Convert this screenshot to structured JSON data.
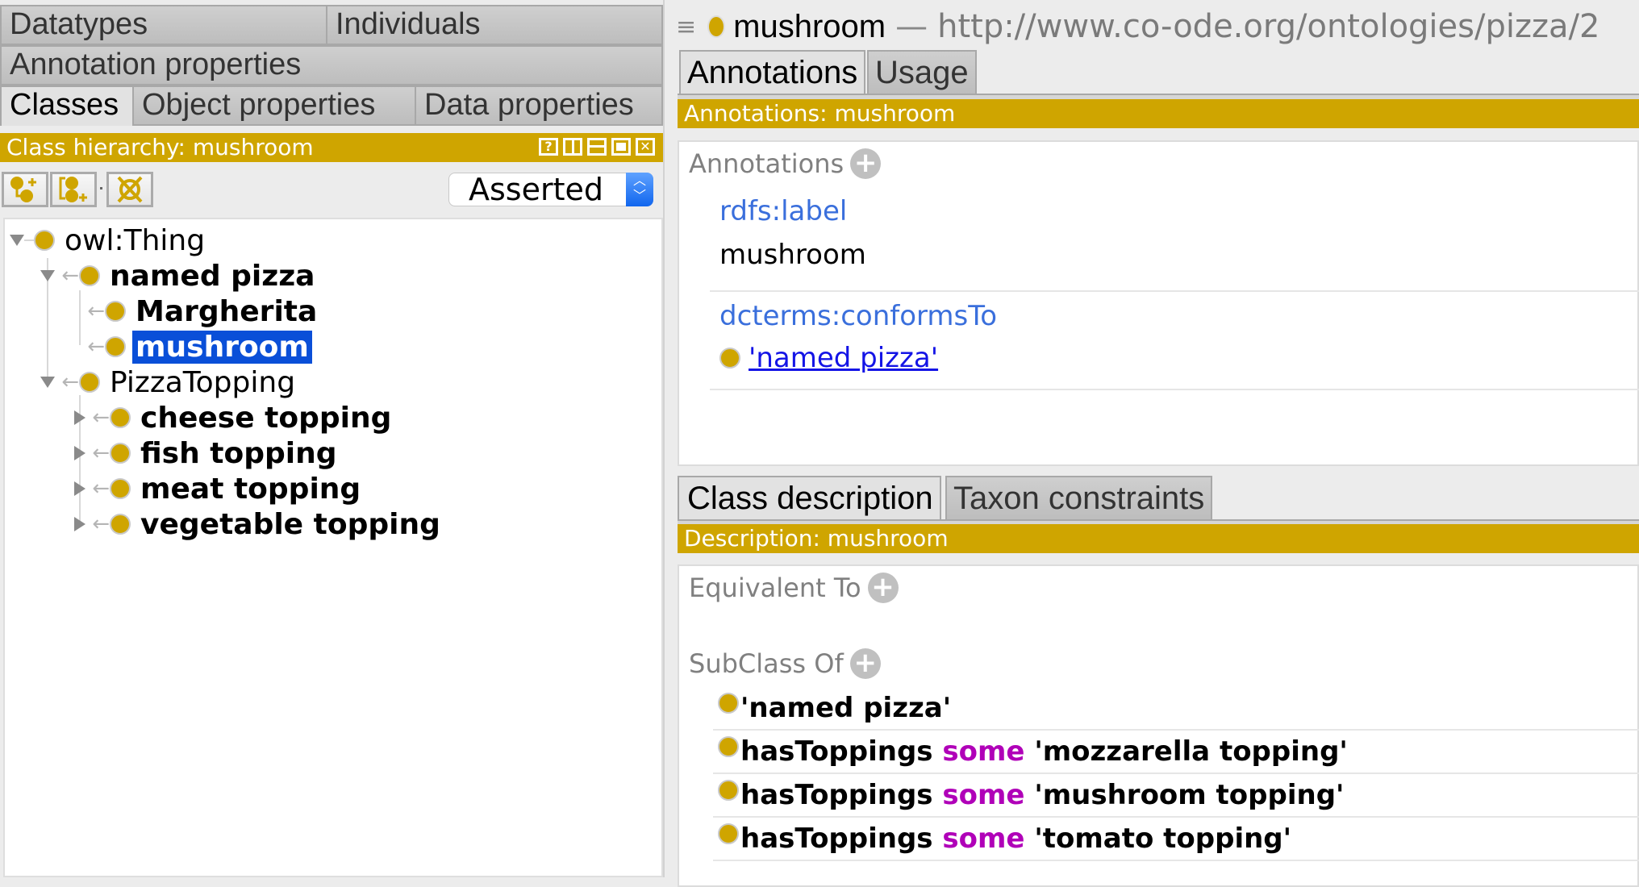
{
  "left_tabs": {
    "row1": [
      "Datatypes",
      "Individuals"
    ],
    "row2": [
      "Annotation properties"
    ],
    "row3": [
      "Classes",
      "Object properties",
      "Data properties"
    ],
    "active": "Classes"
  },
  "hierarchy": {
    "title": "Class hierarchy: mushroom",
    "window_buttons": [
      "?",
      "split-vertical",
      "split-horizontal",
      "maximize",
      "close"
    ],
    "toolbar": [
      "add-subclass",
      "add-sibling-class",
      "delete-class"
    ],
    "mode_select": "Asserted",
    "tree": [
      {
        "label": "owl:Thing",
        "level": 0,
        "expanded": true,
        "bold": false,
        "selected": false
      },
      {
        "label": "named pizza",
        "level": 1,
        "expanded": true,
        "bold": true,
        "selected": false
      },
      {
        "label": "Margherita",
        "level": 2,
        "expanded": null,
        "bold": true,
        "selected": false
      },
      {
        "label": "mushroom",
        "level": 2,
        "expanded": null,
        "bold": true,
        "selected": true
      },
      {
        "label": "PizzaTopping",
        "level": 1,
        "expanded": true,
        "bold": false,
        "selected": false
      },
      {
        "label": "cheese topping",
        "level": 2,
        "expanded": false,
        "bold": true,
        "selected": false
      },
      {
        "label": "fish topping",
        "level": 2,
        "expanded": false,
        "bold": true,
        "selected": false
      },
      {
        "label": "meat topping",
        "level": 2,
        "expanded": false,
        "bold": true,
        "selected": false
      },
      {
        "label": "vegetable topping",
        "level": 2,
        "expanded": false,
        "bold": true,
        "selected": false
      }
    ]
  },
  "header": {
    "entity": "mushroom",
    "separator": "—",
    "iri": "http://www.co-ode.org/ontologies/pizza/2"
  },
  "annotations_tabs": [
    "Annotations",
    "Usage"
  ],
  "annotations": {
    "title": "Annotations: mushroom",
    "section_label": "Annotations",
    "items": [
      {
        "property": "rdfs:label",
        "value": "mushroom",
        "is_link": false
      },
      {
        "property": "dcterms:conformsTo",
        "value": "'named pizza'",
        "is_link": true
      }
    ]
  },
  "description_tabs": [
    "Class description",
    "Taxon constraints"
  ],
  "description": {
    "title": "Description: mushroom",
    "equivalent_label": "Equivalent To",
    "subclass_label": "SubClass Of",
    "subclass_of": [
      {
        "prop": "",
        "kw": "",
        "filler": "'named pizza'"
      },
      {
        "prop": "hasToppings",
        "kw": "some",
        "filler": "'mozzarella topping'"
      },
      {
        "prop": "hasToppings",
        "kw": "some",
        "filler": "'mushroom topping'"
      },
      {
        "prop": "hasToppings",
        "kw": "some",
        "filler": "'tomato topping'"
      }
    ]
  },
  "colors": {
    "accent_gold": "#cfa500",
    "selection_blue": "#0a4fd8",
    "property_blue": "#3a6fdc",
    "keyword_magenta": "#b000b8",
    "link_blue": "#1414e6"
  }
}
